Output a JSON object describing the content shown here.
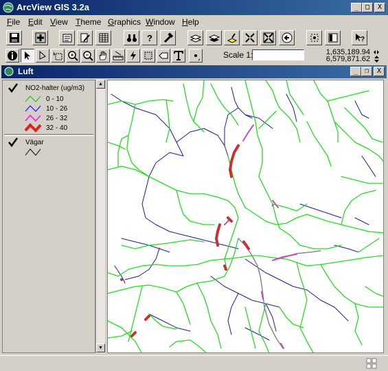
{
  "app": {
    "title": "ArcView GIS 3.2a"
  },
  "window_controls": {
    "minimize": "_",
    "maximize": "□",
    "close": "X"
  },
  "menu": [
    {
      "label": "File",
      "ul": "F",
      "rest": "ile"
    },
    {
      "label": "Edit",
      "ul": "E",
      "rest": "dit"
    },
    {
      "label": "View",
      "ul": "V",
      "rest": "iew"
    },
    {
      "label": "Theme",
      "ul": "T",
      "rest": "heme"
    },
    {
      "label": "Graphics",
      "ul": "G",
      "rest": "raphics"
    },
    {
      "label": "Window",
      "ul": "W",
      "rest": "indow"
    },
    {
      "label": "Help",
      "ul": "H",
      "rest": "elp"
    }
  ],
  "toolbar": {
    "scale_label": "Scale 1:",
    "scale_value": "",
    "coord_x": "1,635,189.94",
    "coord_y": "6,579,871.62"
  },
  "view": {
    "title": "Luft",
    "controls": {
      "minimize": "_",
      "restore": "❐",
      "close": "X"
    }
  },
  "legend": {
    "themes": [
      {
        "name": "NO2-halter (ug/m3)",
        "visible": true,
        "classes": [
          {
            "label": "0 - 10",
            "color": "#00c800"
          },
          {
            "label": "10 - 26",
            "color": "#0000ff"
          },
          {
            "label": "26 - 32",
            "color": "#e040e0"
          },
          {
            "label": "32 - 40",
            "color": "#e02020"
          }
        ]
      },
      {
        "name": "Vägar",
        "visible": true,
        "classes": [
          {
            "label": "",
            "color": "#000000"
          }
        ]
      }
    ]
  },
  "colors": {
    "titlebar_start": "#0a246a",
    "titlebar_end": "#3a6ea5",
    "road_low": "#22dd22",
    "road_mid": "#1a1aa0",
    "road_high_pink": "#c050c0",
    "road_high_red": "#c83232",
    "road_grey": "#808080"
  }
}
